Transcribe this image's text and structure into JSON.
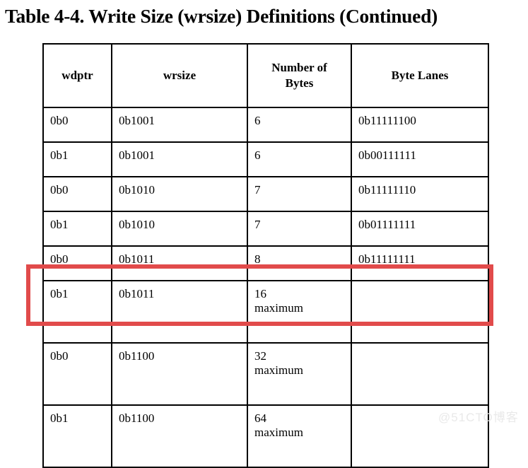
{
  "document": {
    "title": "Table 4-4. Write Size (wrsize) Definitions (Continued)",
    "watermark": "@51CTO博客",
    "highlight_color": "#e14b4b",
    "border_color": "#000000",
    "background_color": "#ffffff"
  },
  "table": {
    "columns": [
      {
        "key": "wdptr",
        "label": "wdptr"
      },
      {
        "key": "wrsize",
        "label": "wrsize"
      },
      {
        "key": "number_of_bytes",
        "label_line1": "Number of",
        "label_line2": "Bytes"
      },
      {
        "key": "byte_lanes",
        "label": "Byte Lanes"
      }
    ],
    "rows": [
      {
        "wdptr": "0b0",
        "wrsize": "0b1001",
        "bytes_line1": "6",
        "bytes_line2": "",
        "byte_lanes": "0b11111100",
        "highlighted": false
      },
      {
        "wdptr": "0b1",
        "wrsize": "0b1001",
        "bytes_line1": "6",
        "bytes_line2": "",
        "byte_lanes": "0b00111111",
        "highlighted": false
      },
      {
        "wdptr": "0b0",
        "wrsize": "0b1010",
        "bytes_line1": "7",
        "bytes_line2": "",
        "byte_lanes": "0b11111110",
        "highlighted": false
      },
      {
        "wdptr": "0b1",
        "wrsize": "0b1010",
        "bytes_line1": "7",
        "bytes_line2": "",
        "byte_lanes": "0b01111111",
        "highlighted": false
      },
      {
        "wdptr": "0b0",
        "wrsize": "0b1011",
        "bytes_line1": "8",
        "bytes_line2": "",
        "byte_lanes": "0b11111111",
        "highlighted": false
      },
      {
        "wdptr": "0b1",
        "wrsize": "0b1011",
        "bytes_line1": "16",
        "bytes_line2": "maximum",
        "byte_lanes": "",
        "highlighted": true
      },
      {
        "wdptr": "0b0",
        "wrsize": "0b1100",
        "bytes_line1": "32",
        "bytes_line2": "maximum",
        "byte_lanes": "",
        "highlighted": false
      },
      {
        "wdptr": "0b1",
        "wrsize": "0b1100",
        "bytes_line1": "64",
        "bytes_line2": "maximum",
        "byte_lanes": "",
        "highlighted": false
      }
    ]
  }
}
